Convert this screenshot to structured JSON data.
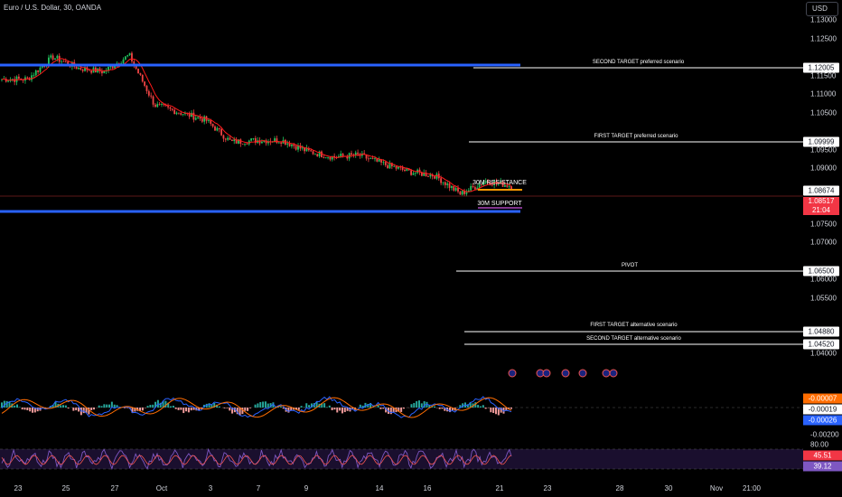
{
  "header": {
    "symbol_title": "Euro / U.S. Dollar, 30, OANDA",
    "currency_button": "USD"
  },
  "colors": {
    "up_candle": "#22c55e",
    "down_candle": "#ef4444",
    "ma_line": "#ff1a1a",
    "blue_level": "#2962ff",
    "orange_level": "#ff9800",
    "annotation_line": "#ffffff",
    "current_price_bg": "#f23645",
    "macd_line": "#2962ff",
    "signal_line": "#ff6d00",
    "rsi_line": "#7e57c2"
  },
  "chart_data": {
    "type": "candlestick",
    "symbol": "Euro / U.S. Dollar",
    "interval": "30",
    "source": "OANDA",
    "y_axis_ticks": [
      "1.13000",
      "1.12500",
      "1.11500",
      "1.11000",
      "1.10500",
      "1.09500",
      "1.09000",
      "1.07500",
      "1.07000",
      "1.06000",
      "1.05500",
      "1.04000"
    ],
    "x_axis_ticks": [
      "23",
      "25",
      "27",
      "Oct",
      "3",
      "7",
      "9",
      "14",
      "16",
      "21",
      "23",
      "28",
      "30",
      "Nov",
      "21:00"
    ],
    "price_path": [
      {
        "date": "Sep 23",
        "price": 1.114
      },
      {
        "date": "Sep 24",
        "price": 1.114
      },
      {
        "date": "Sep 25",
        "price": 1.12
      },
      {
        "date": "Sep 26",
        "price": 1.117
      },
      {
        "date": "Sep 27",
        "price": 1.116
      },
      {
        "date": "Sep 30",
        "price": 1.1205
      },
      {
        "date": "Oct 1",
        "price": 1.107
      },
      {
        "date": "Oct 2",
        "price": 1.105
      },
      {
        "date": "Oct 3",
        "price": 1.103
      },
      {
        "date": "Oct 4",
        "price": 1.097
      },
      {
        "date": "Oct 7",
        "price": 1.0975
      },
      {
        "date": "Oct 8",
        "price": 1.0975
      },
      {
        "date": "Oct 9",
        "price": 1.0945
      },
      {
        "date": "Oct 10",
        "price": 1.093
      },
      {
        "date": "Oct 11",
        "price": 1.0935
      },
      {
        "date": "Oct 14",
        "price": 1.091
      },
      {
        "date": "Oct 15",
        "price": 1.089
      },
      {
        "date": "Oct 16",
        "price": 1.088
      },
      {
        "date": "Oct 17",
        "price": 1.083
      },
      {
        "date": "Oct 18",
        "price": 1.0865
      },
      {
        "date": "Oct 21",
        "price": 1.0852
      }
    ],
    "levels": [
      {
        "label": "SECOND TARGET preferred scenario",
        "price": "1.12005"
      },
      {
        "label": "FIRST TARGET preferred scenario",
        "price": "1.09999"
      },
      {
        "label": "PIVOT",
        "price": "1.06500"
      },
      {
        "label": "FIRST TARGET alternative scenario",
        "price": "1.04880"
      },
      {
        "label": "SECOND TARGET alternative scenario",
        "price": "1.04520"
      }
    ],
    "zone_labels": {
      "resistance": "30M RESISTANCE",
      "support": "30M SUPPORT"
    },
    "resistance_level_price": "1.08674",
    "current_price": "1.08517",
    "countdown": "21:04",
    "macd": {
      "values": [
        "-0.00007",
        "-0.00019",
        "-0.00026"
      ],
      "axis_ticks": [
        "-0.00200"
      ]
    },
    "rsi": {
      "values": [
        "45.51",
        "39.12"
      ],
      "axis_ticks": [
        "80.00"
      ]
    }
  }
}
